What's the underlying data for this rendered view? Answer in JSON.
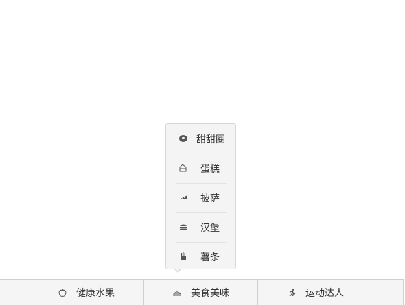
{
  "menu": {
    "items": [
      {
        "label": "甜甜圈",
        "icon": "donut-icon"
      },
      {
        "label": "蛋糕",
        "icon": "cake-icon"
      },
      {
        "label": "披萨",
        "icon": "pizza-icon"
      },
      {
        "label": "汉堡",
        "icon": "burger-icon"
      },
      {
        "label": "薯条",
        "icon": "fries-icon"
      }
    ]
  },
  "tabs": [
    {
      "label": "健康水果",
      "icon": "apple-icon"
    },
    {
      "label": "美食美味",
      "icon": "dish-icon"
    },
    {
      "label": "运动达人",
      "icon": "runner-icon"
    }
  ],
  "colors": {
    "background": "#ffffff",
    "popup": "#f4f4f4",
    "tabbar": "#f5f5f5",
    "border": "#cfcfcf"
  }
}
